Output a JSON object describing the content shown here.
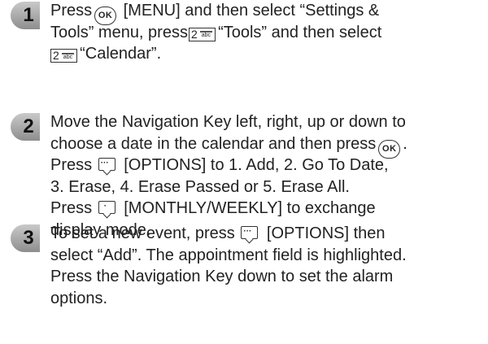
{
  "steps": [
    {
      "number": "1",
      "line1_a": "Press",
      "line1_b": "[MENU] and then select “Settings &",
      "line2_a": "Tools” menu, press",
      "line2_b": "“Tools” and then select",
      "line3_b": "“Calendar”."
    },
    {
      "number": "2",
      "line1": "Move the Navigation Key left, right, up or down to",
      "line2": "choose a date in the calendar and then press",
      "line2_end": ".",
      "line3_a": "Press",
      "line3_b": "[OPTIONS] to 1. Add, 2. Go To Date,",
      "line4": "3. Erase, 4. Erase Passed or 5. Erase All.",
      "line5_a": "Press",
      "line5_b": "[MONTHLY/WEEKLY] to exchange",
      "line6": "display mode."
    },
    {
      "number": "3",
      "line1_a": "To set a new event, press",
      "line1_b": "[OPTIONS] then",
      "line2": "select “Add”. The appointment field is highlighted.",
      "line3": "Press the Navigation Key down to set the alarm",
      "line4": "options."
    }
  ],
  "keys": {
    "ok": "OK",
    "num2": "2",
    "num2_letters": "abc",
    "soft_dots": "···",
    "soft_dot": "·"
  }
}
